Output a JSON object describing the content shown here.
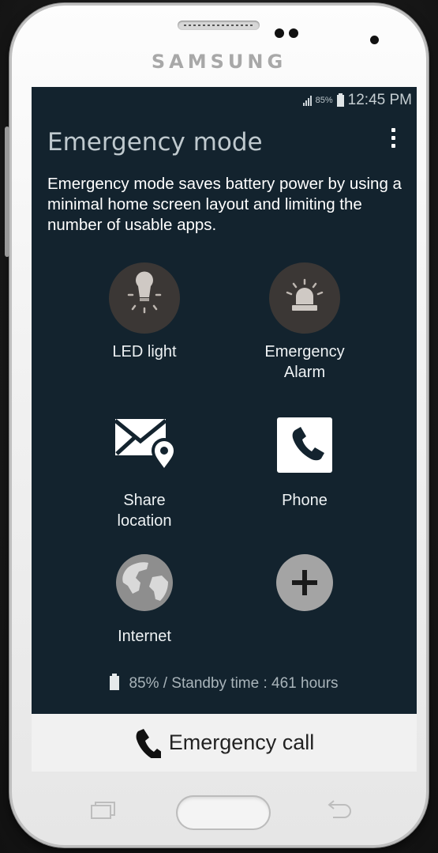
{
  "device": {
    "brand": "SAMSUNG"
  },
  "status_bar": {
    "battery_percent": "85%",
    "time": "12:45 PM"
  },
  "header": {
    "title": "Emergency mode"
  },
  "description": "Emergency mode saves battery power by using a minimal home screen layout and limiting the number of usable apps.",
  "apps": {
    "led": {
      "label": "LED light",
      "icon": "bulb-icon"
    },
    "alarm": {
      "line1": "Emergency",
      "line2": "Alarm",
      "icon": "siren-icon"
    },
    "share": {
      "line1": "Share",
      "line2": "location",
      "icon": "share-location-icon"
    },
    "phone": {
      "label": "Phone",
      "icon": "phone-icon"
    },
    "internet": {
      "label": "Internet",
      "icon": "globe-icon"
    },
    "add": {
      "icon": "plus-icon"
    }
  },
  "footer": {
    "battery_standby": "85% / Standby time : 461 hours"
  },
  "emergency_call": {
    "label": "Emergency call"
  },
  "colors": {
    "screen_bg": "#13232e",
    "icon_circle": "#3b3735",
    "call_bar": "#f1f1f1"
  }
}
